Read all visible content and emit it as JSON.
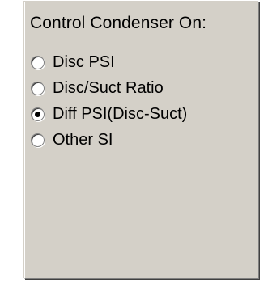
{
  "background_fragments": [
    "e",
    "t"
  ],
  "group": {
    "title": "Control Condenser On:",
    "options": [
      {
        "label": "Disc PSI",
        "selected": false
      },
      {
        "label": "Disc/Suct Ratio",
        "selected": false
      },
      {
        "label": "Diff PSI(Disc-Suct)",
        "selected": true
      },
      {
        "label": "Other SI",
        "selected": false
      }
    ]
  },
  "colors": {
    "panel_face": "#d4d0c8",
    "highlight": "#ffffff",
    "shadow": "#808080",
    "text": "#000000"
  }
}
